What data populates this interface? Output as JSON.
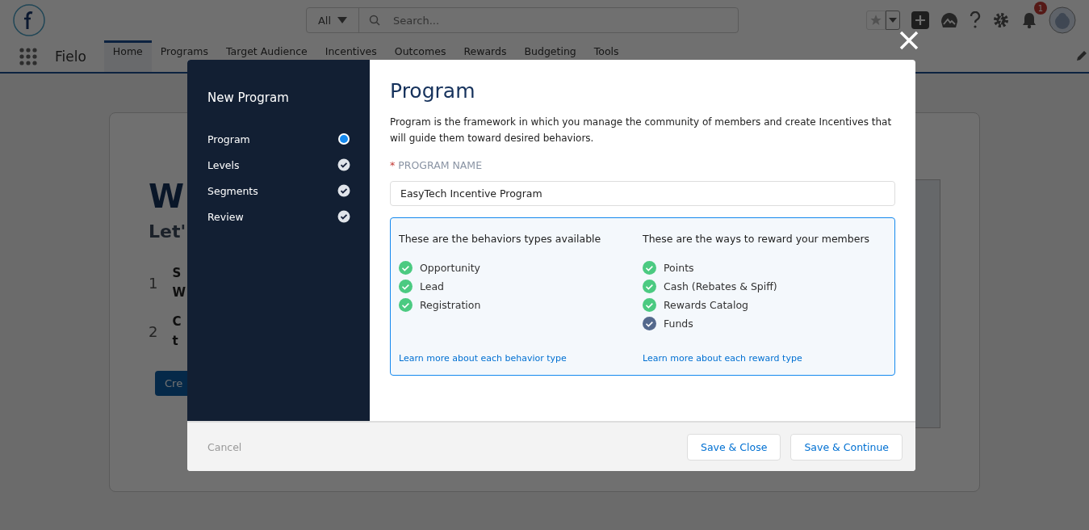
{
  "header": {
    "search_scope": "All",
    "search_placeholder": "Search...",
    "notification_count": "1"
  },
  "nav": {
    "app_name": "Fielo",
    "tabs": [
      {
        "label": "Home",
        "selected": true
      },
      {
        "label": "Programs",
        "selected": false
      },
      {
        "label": "Target Audience",
        "selected": false
      },
      {
        "label": "Incentives",
        "selected": false
      },
      {
        "label": "Outcomes",
        "selected": false
      },
      {
        "label": "Rewards",
        "selected": false
      },
      {
        "label": "Budgeting",
        "selected": false
      },
      {
        "label": "Tools",
        "selected": false
      }
    ]
  },
  "background_card": {
    "heading": "W",
    "subheading": "Let'",
    "steps": [
      {
        "number": "1",
        "lines": [
          "S",
          "W"
        ]
      },
      {
        "number": "2",
        "lines": [
          "C",
          "t"
        ]
      }
    ],
    "button": "Cre"
  },
  "modal": {
    "title": "New Program",
    "steps": [
      {
        "label": "Program",
        "selected": true,
        "done": false
      },
      {
        "label": "Levels",
        "selected": false,
        "done": true
      },
      {
        "label": "Segments",
        "selected": false,
        "done": true
      },
      {
        "label": "Review",
        "selected": false,
        "done": true
      }
    ],
    "heading": "Program",
    "description": "Program is the framework in which you manage the community of members and create Incentives that will guide them toward desired behaviors.",
    "field": {
      "label": "PROGRAM NAME",
      "required_mark": "*",
      "value": "EasyTech Incentive Program"
    },
    "columns": [
      {
        "title": "These are the behaviors types available",
        "items": [
          {
            "label": "Opportunity",
            "color": "#4bca81"
          },
          {
            "label": "Lead",
            "color": "#4bca81"
          },
          {
            "label": "Registration",
            "color": "#4bca81"
          }
        ],
        "link": "Learn more about each behavior type"
      },
      {
        "title": "These are the ways to reward your members",
        "items": [
          {
            "label": "Points",
            "color": "#4bca81"
          },
          {
            "label": "Cash (Rebates & Spiff)",
            "color": "#4bca81"
          },
          {
            "label": "Rewards Catalog",
            "color": "#4bca81"
          },
          {
            "label": "Funds",
            "color": "#54698d"
          }
        ],
        "link": "Learn more about each reward type"
      }
    ],
    "cancel": "Cancel",
    "buttons": [
      "Save & Close",
      "Save & Continue"
    ]
  }
}
